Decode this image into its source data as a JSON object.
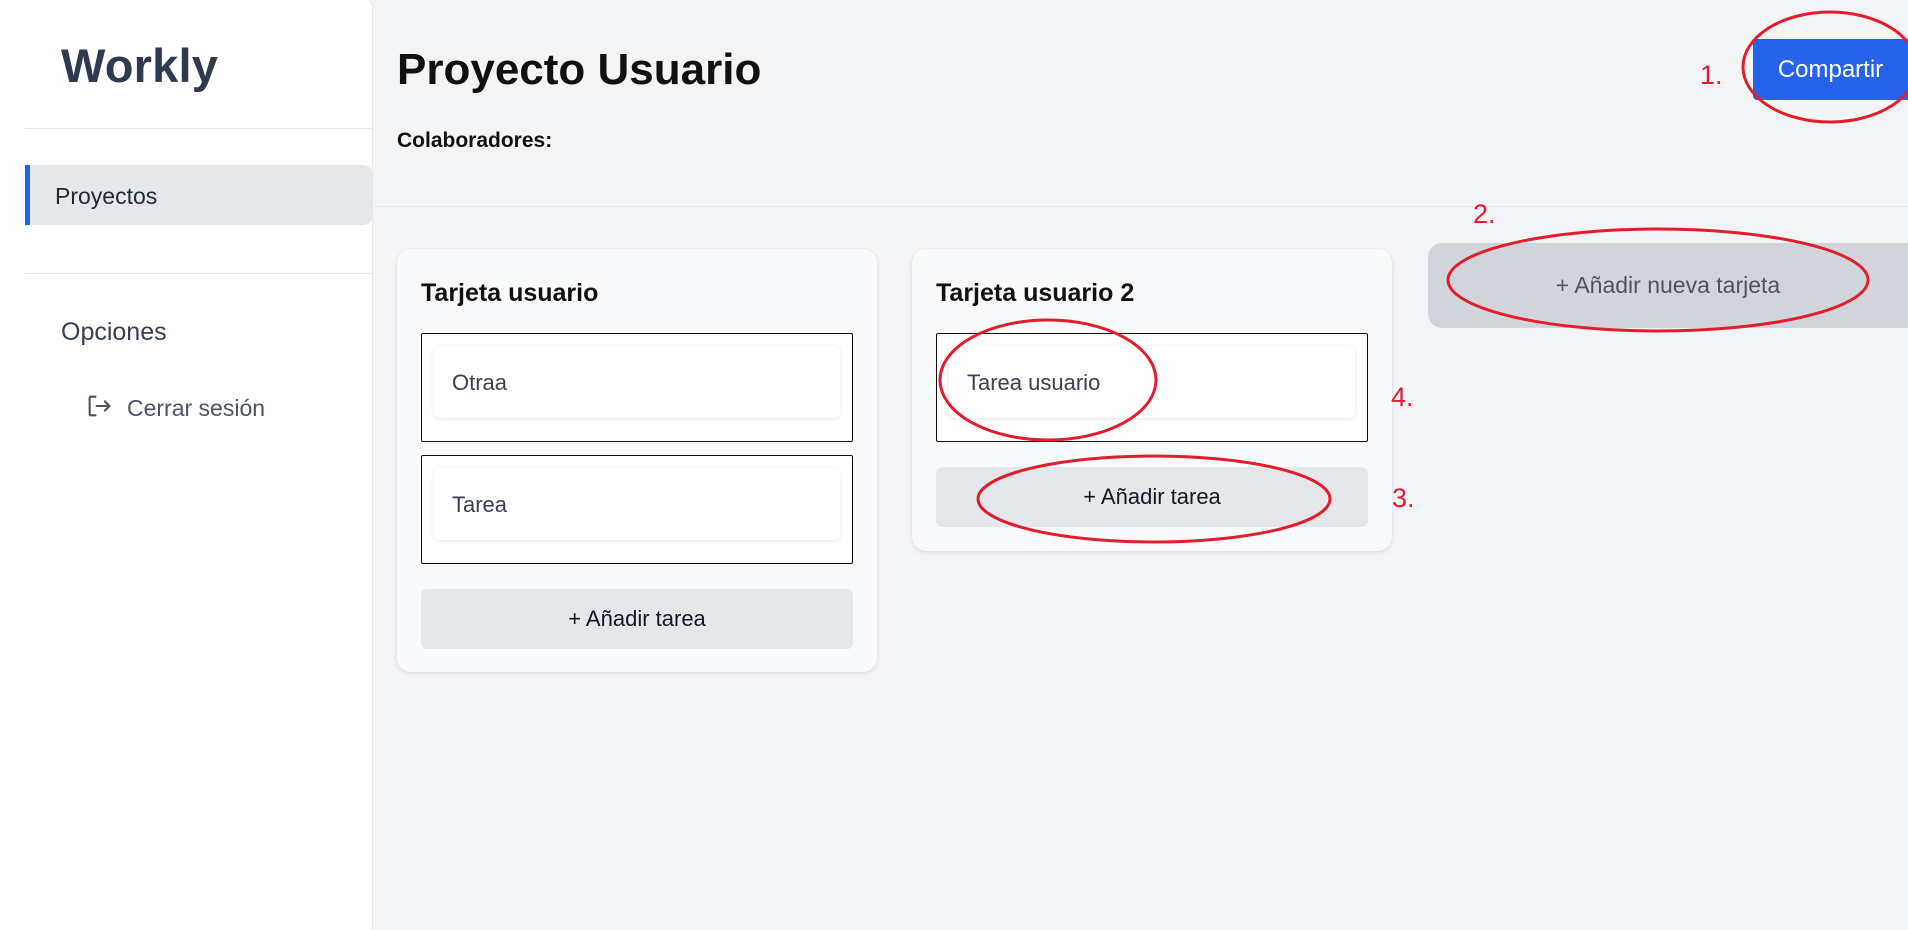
{
  "sidebar": {
    "logo": "Workly",
    "nav_items": [
      {
        "label": "Proyectos",
        "active": true
      }
    ],
    "section_title": "Opciones",
    "logout_label": "Cerrar sesión",
    "logout_icon": "logout-icon"
  },
  "header": {
    "title": "Proyecto Usuario",
    "collaborators_label": "Colaboradores:",
    "share_label": "Compartir"
  },
  "board": {
    "columns": [
      {
        "title": "Tarjeta usuario",
        "tasks": [
          "Otraa",
          "Tarea"
        ],
        "add_task_label": "+ Añadir tarea"
      },
      {
        "title": "Tarjeta usuario 2",
        "tasks": [
          "Tarea usuario"
        ],
        "add_task_label": "+ Añadir tarea"
      }
    ],
    "add_card_label": "+ Añadir nueva tarjeta"
  },
  "annotations": {
    "labels": [
      "1.",
      "2.",
      "3.",
      "4."
    ],
    "color": "#e11d2e"
  },
  "colors": {
    "accent": "#2563eb",
    "background": "#f3f4f6",
    "sidebar": "#ffffff"
  }
}
